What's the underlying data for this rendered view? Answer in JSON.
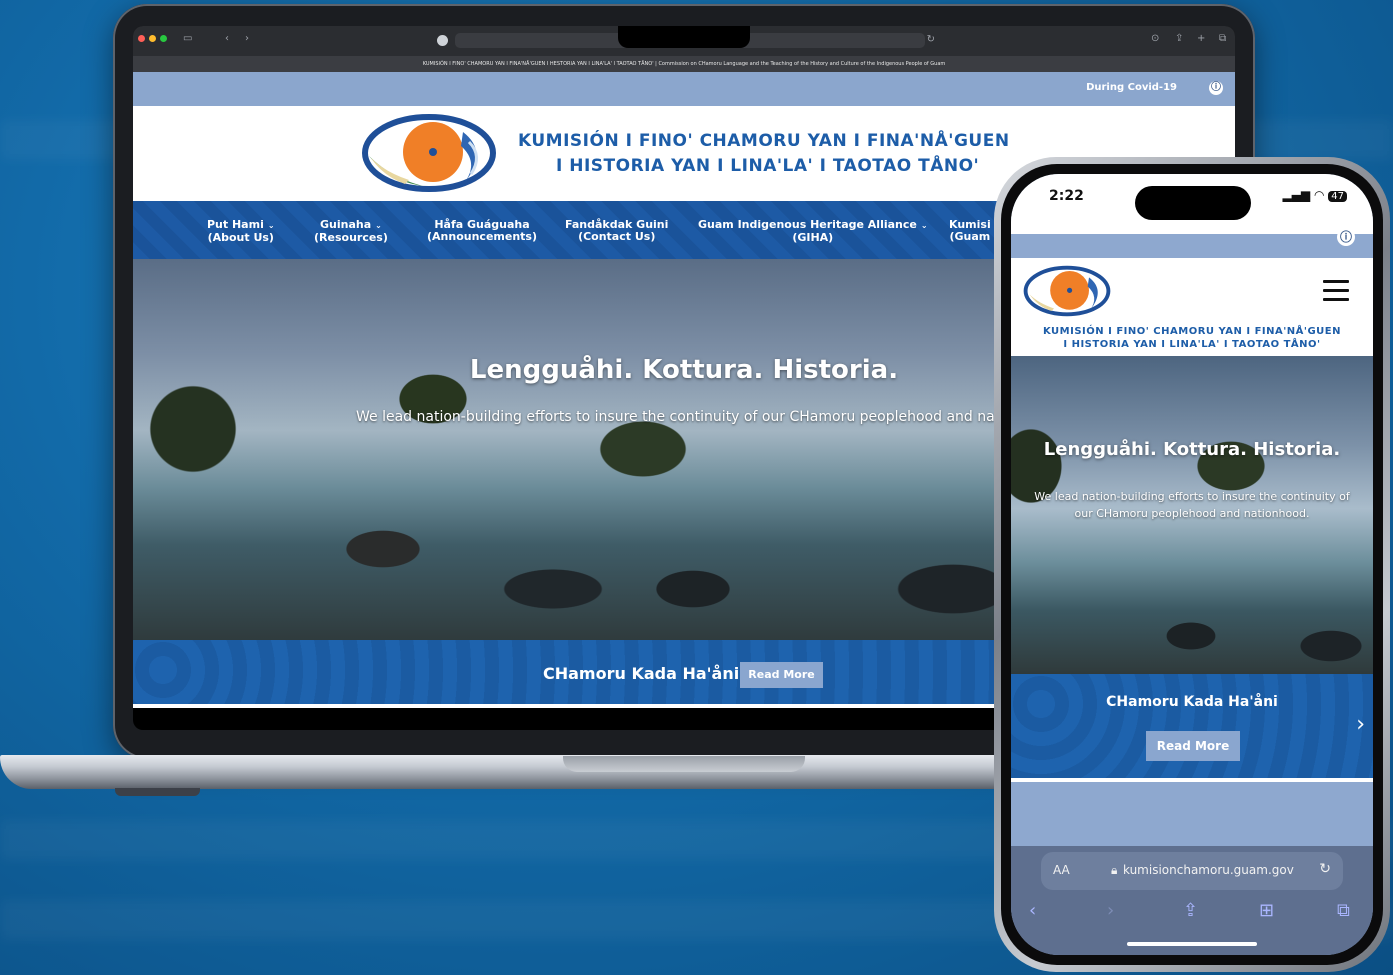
{
  "laptop": {
    "page_title_bar": "KUMISIÓN I FINO' CHAMORU YAN I FINA'NÅ'GUEN I HESTORIA YAN I LINA'LA' I TAOTAO TÅNO' | Commission on CHamoru Language and the Teaching of the History and Culture of the Indigenous People of Guam",
    "covid_link": "During Covid-19",
    "logo_line1": "KUMISIÓN I FINO' CHAMORU YAN I FINA'NÅ'GUEN",
    "logo_line2": "I HISTORIA YAN I LINA'LA' I TAOTAO TÅNO'",
    "nav": [
      {
        "line1": "Put Hami",
        "line2": "(About Us)",
        "dropdown": true
      },
      {
        "line1": "Guinaha",
        "line2": "(Resources)",
        "dropdown": true
      },
      {
        "line1": "Håfa Guáguaha",
        "line2": "(Announcements)",
        "dropdown": false
      },
      {
        "line1": "Fandåkdak Guini",
        "line2": "(Contact Us)",
        "dropdown": false
      },
      {
        "line1": "Guam Indigenous Heritage Alliance",
        "line2": "(GIHA)",
        "dropdown": true
      },
      {
        "line1": "Kumisi",
        "line2": "(Guam",
        "dropdown": false
      }
    ],
    "hero_title": "Lengguåhi. Kottura. Historia.",
    "hero_subtitle": "We lead nation-building efforts to insure the continuity of our CHamoru peoplehood and nationhood.",
    "strip_title": "CHamoru Kada Ha'åni",
    "read_more": "Read More"
  },
  "phone": {
    "time": "2:22",
    "battery": "47",
    "logo_line1": "KUMISIÓN I FINO' CHAMORU YAN I FINA'NÅ'GUEN",
    "logo_line2": "I HISTORIA YAN I LINA'LA' I TAOTAO TÅNO'",
    "hero_title": "Lengguåhi. Kottura. Historia.",
    "hero_subtitle_line1": "We lead nation-building efforts to insure the continuity of",
    "hero_subtitle_line2": "our CHamoru peoplehood and nationhood.",
    "strip_title": "CHamoru Kada Ha'åni",
    "read_more": "Read More",
    "url_aa": "AA",
    "url": "kumisionchamoru.guam.gov"
  },
  "colors": {
    "brand_blue": "#1d5da8",
    "covid_bar": "#8ba6cd",
    "logo_orange": "#f07f27"
  }
}
